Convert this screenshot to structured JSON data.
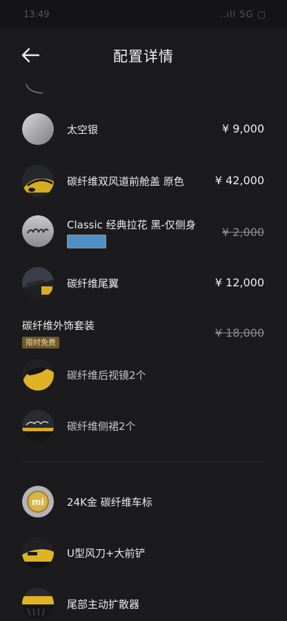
{
  "status": {
    "time": "13:49",
    "icons": "..ıll 5G ▢"
  },
  "header": {
    "title": "配置详情"
  },
  "items": [
    {
      "name": "太空银",
      "price": "¥ 9,000"
    },
    {
      "name": "碳纤维双风道前舱盖 原色",
      "price": "¥ 42,000"
    },
    {
      "name": "Classic 经典拉花 黑-仅侧身",
      "price": "¥ 2,000",
      "swatch_color": "#4d8fc7"
    },
    {
      "name": "碳纤维尾翼",
      "price": "¥ 12,000"
    }
  ],
  "package": {
    "title": "碳纤维外饰套装",
    "badge": "限时免费",
    "price": "¥ 18,000",
    "children": [
      {
        "name": "碳纤维后视镜2个"
      },
      {
        "name": "碳纤维侧裙2个"
      }
    ]
  },
  "extras": [
    {
      "name": "24K金 碳纤维车标",
      "logo_text": "mi"
    },
    {
      "name": "U型风刀+大前铲"
    },
    {
      "name": "尾部主动扩散器"
    }
  ],
  "colors": {
    "background": "#1b1b1d",
    "accent_badge": "#6e5a2e",
    "car_yellow": "#e0b324"
  }
}
